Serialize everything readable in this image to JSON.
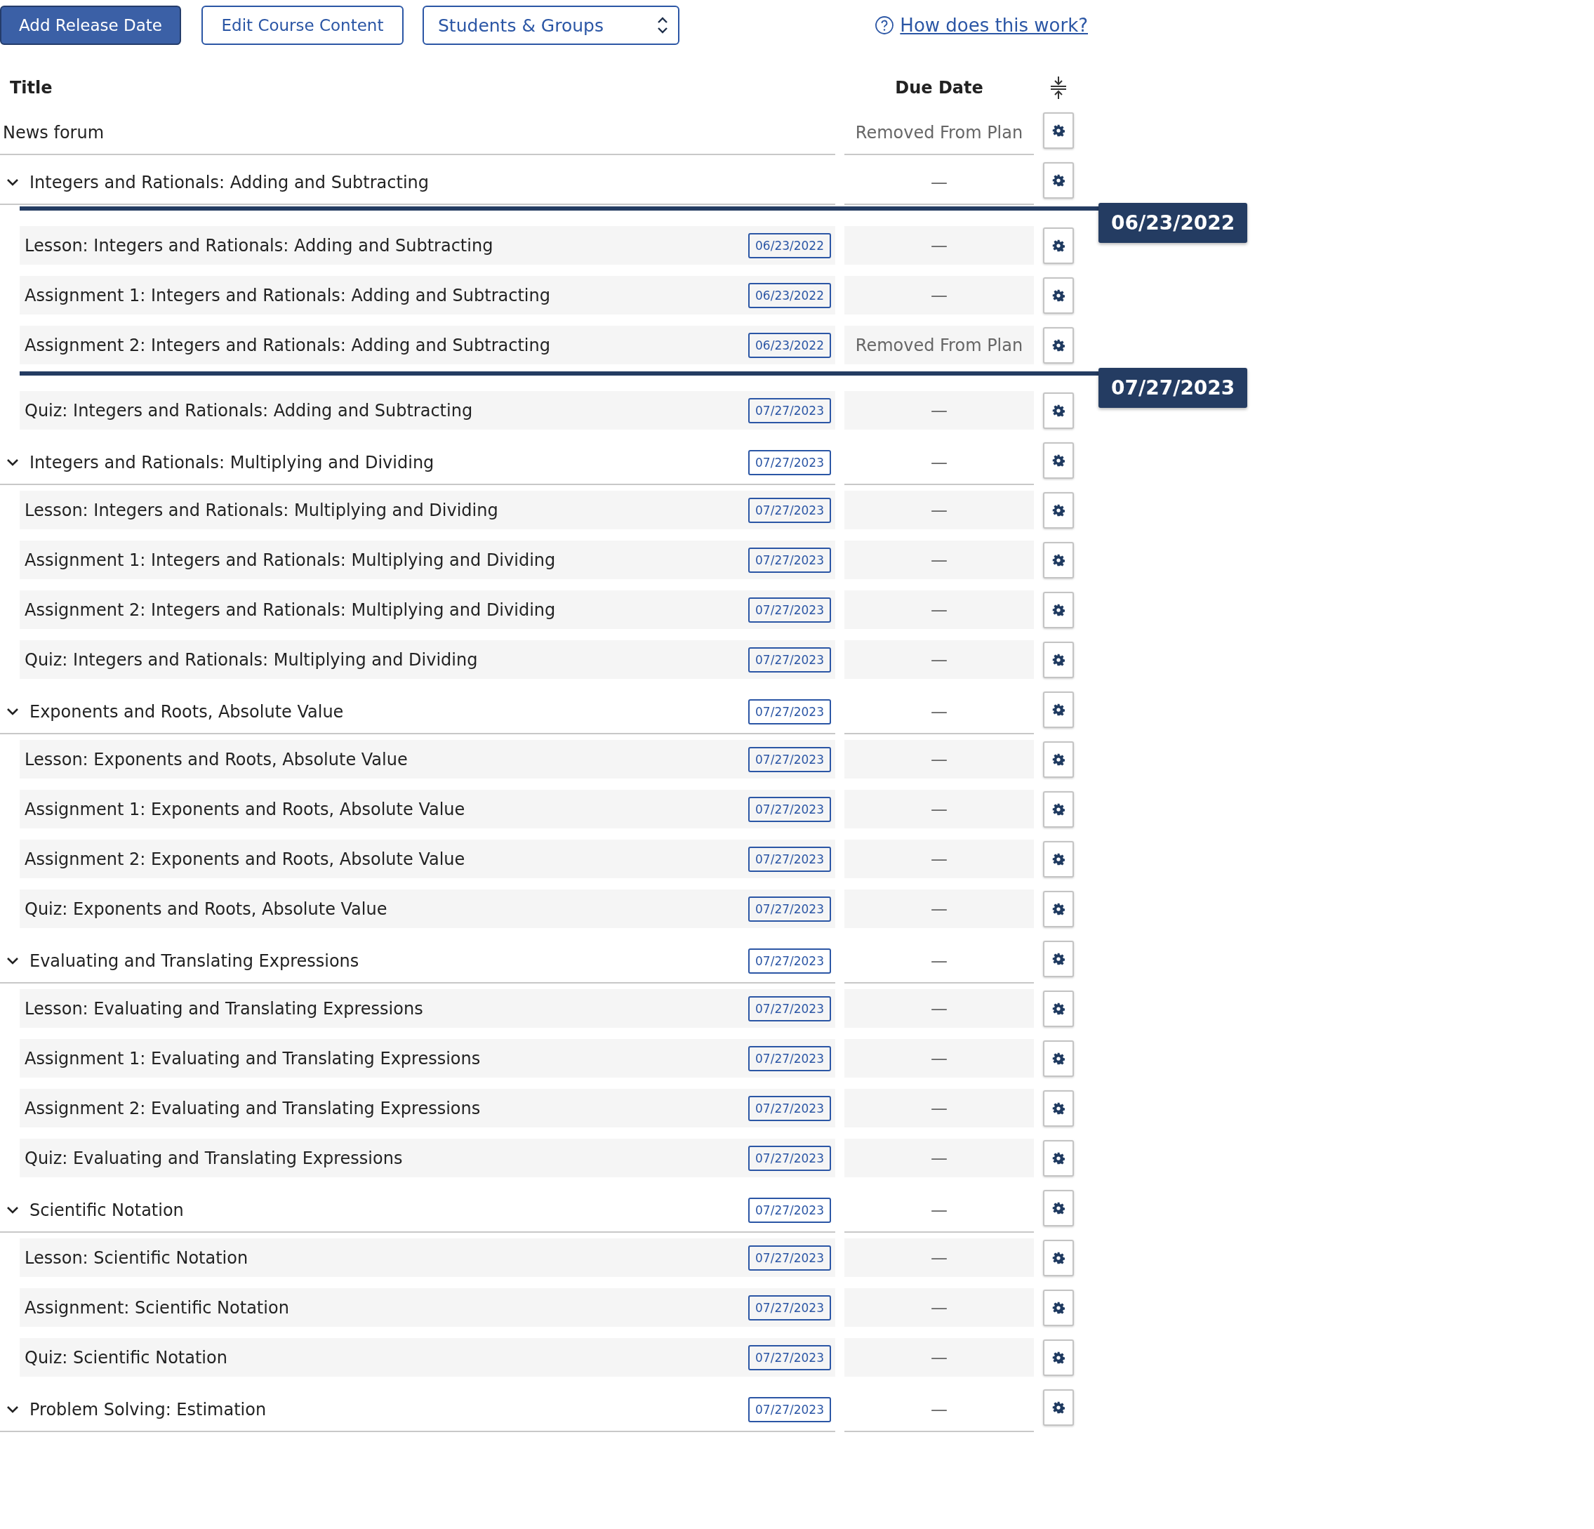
{
  "toolbar": {
    "add_button": "Add Release Date",
    "edit_button": "Edit Course Content",
    "group_select": "Students & Groups",
    "help_link": "How does this work?"
  },
  "columns": {
    "title": "Title",
    "due": "Due Date"
  },
  "rows": [
    {
      "kind": "plain",
      "title": "News forum",
      "due": "Removed From Plan"
    },
    {
      "kind": "section",
      "expanded": true,
      "title": "Integers and Rationals: Adding and Subtracting",
      "due": "—"
    },
    {
      "kind": "marker",
      "date": "06/23/2022"
    },
    {
      "kind": "item",
      "title": "Lesson: Integers and Rationals: Adding and Subtracting",
      "release": "06/23/2022",
      "due": "—"
    },
    {
      "kind": "item",
      "title": "Assignment 1: Integers and Rationals: Adding and Subtracting",
      "release": "06/23/2022",
      "due": "—"
    },
    {
      "kind": "item",
      "title": "Assignment 2: Integers and Rationals: Adding and Subtracting",
      "release": "06/23/2022",
      "due": "Removed From Plan"
    },
    {
      "kind": "marker",
      "date": "07/27/2023"
    },
    {
      "kind": "item",
      "title": "Quiz: Integers and Rationals: Adding and Subtracting",
      "release": "07/27/2023",
      "due": "—"
    },
    {
      "kind": "section",
      "expanded": true,
      "title": "Integers and Rationals: Multiplying and Dividing",
      "release": "07/27/2023",
      "due": "—"
    },
    {
      "kind": "item",
      "title": "Lesson: Integers and Rationals: Multiplying and Dividing",
      "release": "07/27/2023",
      "due": "—"
    },
    {
      "kind": "item",
      "title": "Assignment 1: Integers and Rationals: Multiplying and Dividing",
      "release": "07/27/2023",
      "due": "—"
    },
    {
      "kind": "item",
      "title": "Assignment 2: Integers and Rationals: Multiplying and Dividing",
      "release": "07/27/2023",
      "due": "—"
    },
    {
      "kind": "item",
      "title": "Quiz: Integers and Rationals: Multiplying and Dividing",
      "release": "07/27/2023",
      "due": "—"
    },
    {
      "kind": "section",
      "expanded": true,
      "title": "Exponents and Roots, Absolute Value",
      "release": "07/27/2023",
      "due": "—"
    },
    {
      "kind": "item",
      "title": "Lesson: Exponents and Roots, Absolute Value",
      "release": "07/27/2023",
      "due": "—"
    },
    {
      "kind": "item",
      "title": "Assignment 1: Exponents and Roots, Absolute Value",
      "release": "07/27/2023",
      "due": "—"
    },
    {
      "kind": "item",
      "title": "Assignment 2: Exponents and Roots, Absolute Value",
      "release": "07/27/2023",
      "due": "—"
    },
    {
      "kind": "item",
      "title": "Quiz: Exponents and Roots, Absolute Value",
      "release": "07/27/2023",
      "due": "—"
    },
    {
      "kind": "section",
      "expanded": true,
      "title": "Evaluating and Translating Expressions",
      "release": "07/27/2023",
      "due": "—"
    },
    {
      "kind": "item",
      "title": "Lesson: Evaluating and Translating Expressions",
      "release": "07/27/2023",
      "due": "—"
    },
    {
      "kind": "item",
      "title": "Assignment 1: Evaluating and Translating Expressions",
      "release": "07/27/2023",
      "due": "—"
    },
    {
      "kind": "item",
      "title": "Assignment 2: Evaluating and Translating Expressions",
      "release": "07/27/2023",
      "due": "—"
    },
    {
      "kind": "item",
      "title": "Quiz: Evaluating and Translating Expressions",
      "release": "07/27/2023",
      "due": "—"
    },
    {
      "kind": "section",
      "expanded": true,
      "title": "Scientific Notation",
      "release": "07/27/2023",
      "due": "—"
    },
    {
      "kind": "item",
      "title": "Lesson: Scientific Notation",
      "release": "07/27/2023",
      "due": "—"
    },
    {
      "kind": "item",
      "title": "Assignment: Scientific Notation",
      "release": "07/27/2023",
      "due": "—"
    },
    {
      "kind": "item",
      "title": "Quiz: Scientific Notation",
      "release": "07/27/2023",
      "due": "—"
    },
    {
      "kind": "section",
      "expanded": true,
      "title": "Problem Solving: Estimation",
      "release": "07/27/2023",
      "due": "—"
    }
  ]
}
